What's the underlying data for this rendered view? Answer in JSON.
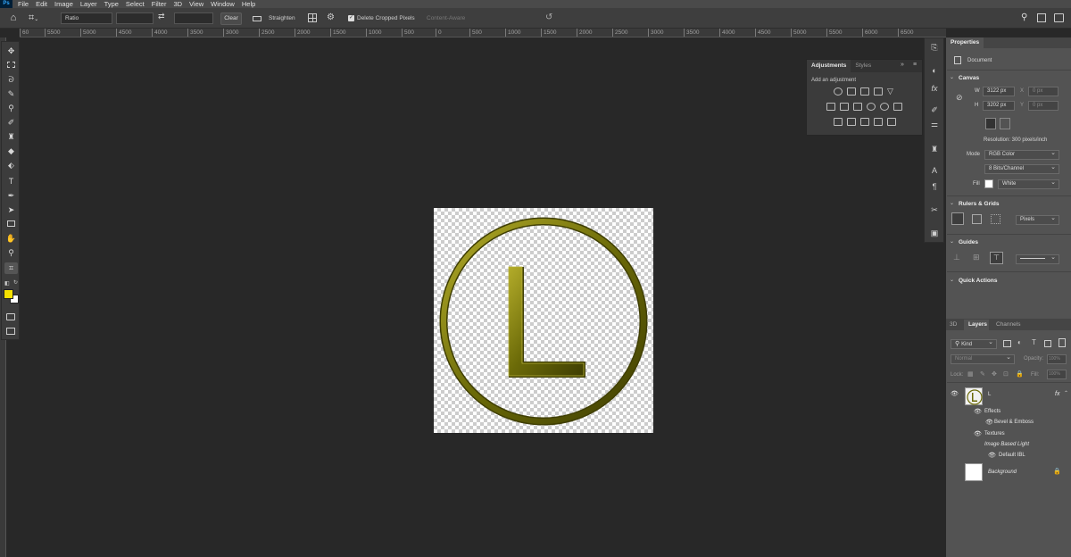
{
  "app": {
    "logo": "Ps"
  },
  "menu": [
    "File",
    "Edit",
    "Image",
    "Layer",
    "Type",
    "Select",
    "Filter",
    "3D",
    "View",
    "Window",
    "Help"
  ],
  "options": {
    "ratio": "Ratio",
    "clear": "Clear",
    "straighten": "Straighten",
    "delete_cropped": "Delete Cropped Pixels",
    "content_aware": "Content-Aware"
  },
  "ruler": [
    "60",
    "5500",
    "5000",
    "4500",
    "4000",
    "3500",
    "3000",
    "2500",
    "2000",
    "1500",
    "1000",
    "500",
    "0",
    "500",
    "1000",
    "1500",
    "2000",
    "2500",
    "3000",
    "3500",
    "4000",
    "4500",
    "5000",
    "5500",
    "6000",
    "6500"
  ],
  "colors": {
    "foreground": "#f5e100",
    "background": "#ffffff",
    "emboss": "#6b6a08"
  },
  "canvas": {
    "letter": "L"
  },
  "adjustments": {
    "tab_active": "Adjustments",
    "tab_other": "Styles",
    "add_label": "Add an adjustment"
  },
  "properties": {
    "tab": "Properties",
    "doc_label": "Document",
    "canvas_title": "Canvas",
    "w_label": "W",
    "w_value": "3122 px",
    "x_label": "X",
    "x_value": "0 px",
    "h_label": "H",
    "h_value": "3202 px",
    "y_label": "Y",
    "y_value": "0 px",
    "resolution": "Resolution: 300 pixels/inch",
    "mode_label": "Mode",
    "mode_value": "RGB Color",
    "depth_value": "8 Bits/Channel",
    "fill_label": "Fill",
    "fill_value": "White",
    "rulers_title": "Rulers & Grids",
    "units_value": "Pixels",
    "guides_title": "Guides",
    "quick_actions": "Quick Actions"
  },
  "layers_panel": {
    "tabs": [
      "3D",
      "Layers",
      "Channels"
    ],
    "kind": "Kind",
    "blend": "Normal",
    "opacity_label": "Opacity:",
    "opacity_value": "100%",
    "lock_label": "Lock:",
    "fill_label": "Fill:",
    "fill_value": "100%",
    "layer_name": "L",
    "fx": "fx",
    "effects": "Effects",
    "bevel": "Bevel & Emboss",
    "textures": "Textures",
    "ibl": "Image Based Light",
    "default_ibl": "Default IBL",
    "background": "Background"
  }
}
